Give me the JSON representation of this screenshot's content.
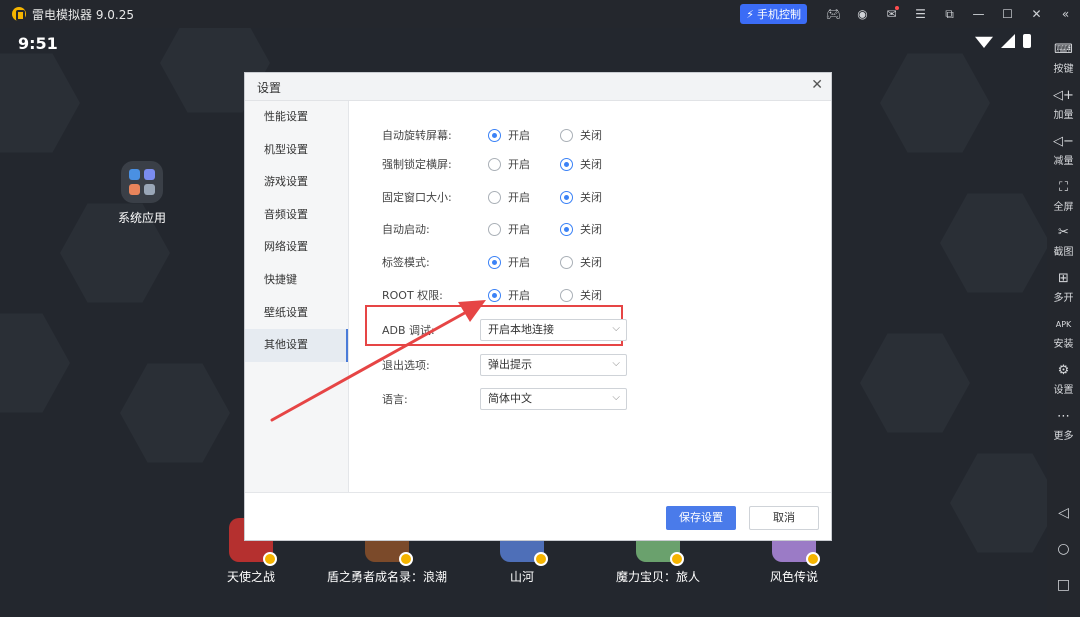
{
  "window": {
    "title": "雷电模拟器 9.0.25",
    "phone_control": "手机控制"
  },
  "status": {
    "time": "9:51"
  },
  "desktop": {
    "system_app_label": "系统应用",
    "dock": [
      {
        "label": "天使之战",
        "color": "#b5302f"
      },
      {
        "label": "盾之勇者成名录：浪潮",
        "color": "#7b4a2a"
      },
      {
        "label": "山河",
        "color": "#4e6fb8"
      },
      {
        "label": "魔力宝贝：旅人",
        "color": "#6aa16d"
      },
      {
        "label": "风色传说",
        "color": "#9b7bc6"
      }
    ]
  },
  "sidebar": [
    {
      "icon": "keyboard-icon",
      "label": "按键"
    },
    {
      "icon": "volume-up-icon",
      "label": "加量"
    },
    {
      "icon": "volume-down-icon",
      "label": "减量"
    },
    {
      "icon": "fullscreen-icon",
      "label": "全屏"
    },
    {
      "icon": "scissors-icon",
      "label": "截图"
    },
    {
      "icon": "multi-open-icon",
      "label": "多开"
    },
    {
      "icon": "apk-install-icon",
      "label": "安装"
    },
    {
      "icon": "settings-icon",
      "label": "设置"
    },
    {
      "icon": "more-icon",
      "label": "更多"
    }
  ],
  "dialog": {
    "title": "设置",
    "nav": [
      "性能设置",
      "机型设置",
      "游戏设置",
      "音频设置",
      "网络设置",
      "快捷键",
      "壁纸设置",
      "其他设置"
    ],
    "active_nav": "其他设置",
    "on_label": "开启",
    "off_label": "关闭",
    "radio_rows": [
      {
        "label": "自动旋转屏幕:",
        "selected": "on"
      },
      {
        "label": "强制锁定横屏:",
        "selected": "off"
      },
      {
        "label": "固定窗口大小:",
        "selected": "off"
      },
      {
        "label": "自动启动:",
        "selected": "off"
      },
      {
        "label": "标签模式:",
        "selected": "on"
      },
      {
        "label": "ROOT 权限:",
        "selected": "on"
      }
    ],
    "select_rows": [
      {
        "label": "ADB 调试:",
        "value": "开启本地连接"
      },
      {
        "label": "退出选项:",
        "value": "弹出提示"
      },
      {
        "label": "语言:",
        "value": "简体中文"
      }
    ],
    "save_label": "保存设置",
    "cancel_label": "取消"
  },
  "colors": {
    "accent": "#4a7bea",
    "annotation": "#e64545"
  }
}
